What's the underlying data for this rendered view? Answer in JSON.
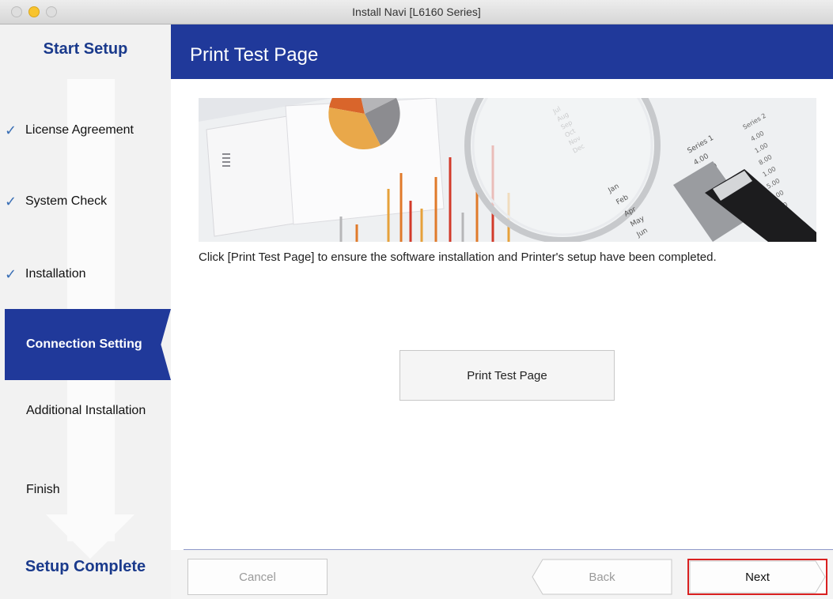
{
  "window": {
    "title": "Install Navi [L6160 Series]"
  },
  "sidebar": {
    "top_header": "Start Setup",
    "bottom_header": "Setup Complete",
    "steps": [
      {
        "label": "License Agreement",
        "state": "done"
      },
      {
        "label": "System Check",
        "state": "done"
      },
      {
        "label": "Installation",
        "state": "done"
      },
      {
        "label": "Connection Setting",
        "state": "current"
      },
      {
        "label": "Additional Installation",
        "state": "pending"
      },
      {
        "label": "Finish",
        "state": "pending"
      }
    ]
  },
  "main": {
    "title": "Print Test Page",
    "instructions": "Click [Print Test Page] to ensure the software installation and Printer's setup have been completed.",
    "print_button": "Print Test Page"
  },
  "footer": {
    "cancel": "Cancel",
    "back": "Back",
    "next": "Next"
  },
  "colors": {
    "brand_blue": "#20399a",
    "highlight_red": "#d92020",
    "check_blue": "#3a6fb5"
  }
}
